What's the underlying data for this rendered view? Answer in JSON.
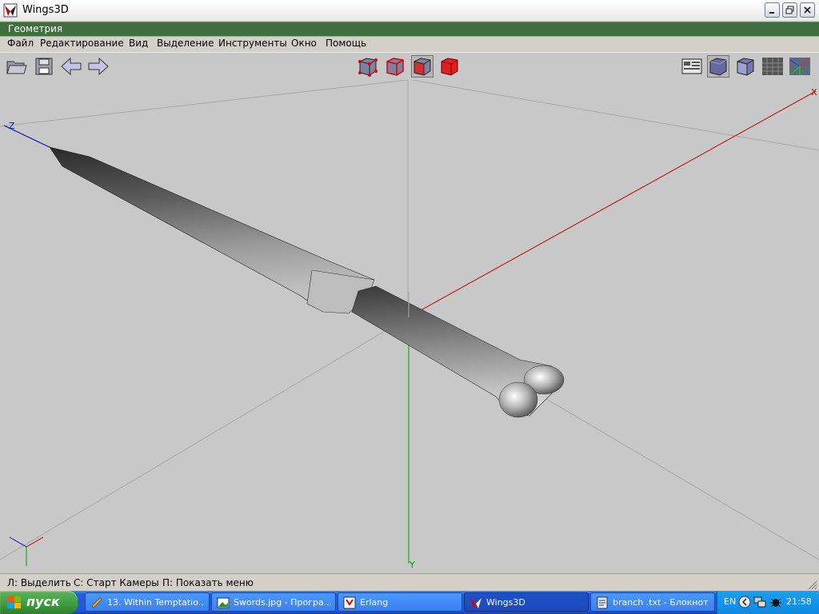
{
  "window": {
    "title": "Wings3D"
  },
  "geometry_panel": {
    "title": "Геометрия"
  },
  "menu": {
    "items": [
      "Файл",
      "Редактирование",
      "Вид",
      "Выделение",
      "Инструменты",
      "Окно",
      "Помощь"
    ]
  },
  "toolbar": {
    "left": [
      "open-folder-icon",
      "save-icon",
      "undo-arrow-icon",
      "redo-arrow-icon"
    ],
    "select_modes": [
      "vertex-mode-icon",
      "edge-mode-icon",
      "face-mode-icon",
      "body-mode-icon"
    ],
    "right": [
      "workmode-icon",
      "smooth-shade-icon",
      "flat-shade-icon",
      "groundplane-icon",
      "axes-icon"
    ]
  },
  "viewport": {
    "axis_labels": {
      "x": "X",
      "y": "Y",
      "z": "Z"
    },
    "colors": {
      "background": "#c8c8c8",
      "x_axis": "#c00000",
      "y_axis": "#00a000",
      "z_axis": "#0000c0"
    }
  },
  "status": {
    "items": [
      "Л: Выделить",
      "С: Старт Камеры",
      "П: Показать меню"
    ]
  },
  "taskbar": {
    "start_label": "пуск",
    "tasks": [
      {
        "label": "13. Within Temptatio...",
        "icon": "media-player-icon"
      },
      {
        "label": "Swords.jpg - Програ...",
        "icon": "image-viewer-icon"
      },
      {
        "label": "Erlang",
        "icon": "erlang-icon"
      },
      {
        "label": "Wings3D",
        "icon": "wings3d-icon"
      },
      {
        "label": "branch .txt - Блокнот",
        "icon": "notepad-icon"
      }
    ],
    "tray": {
      "language": "EN",
      "time": "21:58"
    }
  }
}
